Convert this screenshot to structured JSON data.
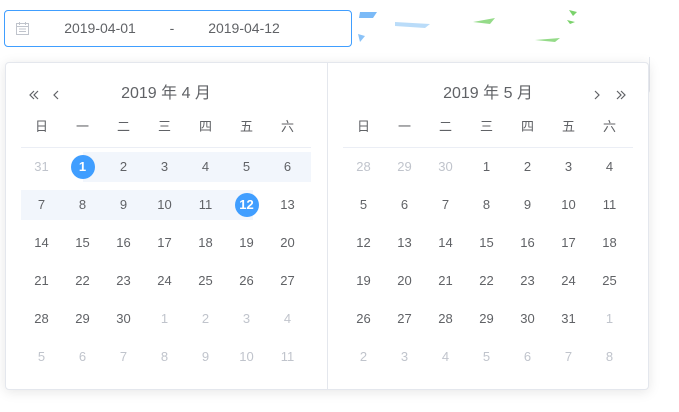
{
  "picker": {
    "start_value": "2019-04-01",
    "separator": "-",
    "end_value": "2019-04-12"
  },
  "left": {
    "title": "2019 年 4 月",
    "weekdays": [
      "日",
      "一",
      "二",
      "三",
      "四",
      "五",
      "六"
    ],
    "rows": [
      [
        "31",
        "1",
        "2",
        "3",
        "4",
        "5",
        "6"
      ],
      [
        "7",
        "8",
        "9",
        "10",
        "11",
        "12",
        "13"
      ],
      [
        "14",
        "15",
        "16",
        "17",
        "18",
        "19",
        "20"
      ],
      [
        "21",
        "22",
        "23",
        "24",
        "25",
        "26",
        "27"
      ],
      [
        "28",
        "29",
        "30",
        "1",
        "2",
        "3",
        "4"
      ],
      [
        "5",
        "6",
        "7",
        "8",
        "9",
        "10",
        "11"
      ]
    ]
  },
  "right": {
    "title": "2019 年 5 月",
    "weekdays": [
      "日",
      "一",
      "二",
      "三",
      "四",
      "五",
      "六"
    ],
    "rows": [
      [
        "28",
        "29",
        "30",
        "1",
        "2",
        "3",
        "4"
      ],
      [
        "5",
        "6",
        "7",
        "8",
        "9",
        "10",
        "11"
      ],
      [
        "12",
        "13",
        "14",
        "15",
        "16",
        "17",
        "18"
      ],
      [
        "19",
        "20",
        "21",
        "22",
        "23",
        "24",
        "25"
      ],
      [
        "26",
        "27",
        "28",
        "29",
        "30",
        "31",
        "1"
      ],
      [
        "2",
        "3",
        "4",
        "5",
        "6",
        "7",
        "8"
      ]
    ]
  },
  "colors": {
    "accent": "#409eff",
    "range": "#f2f6fc",
    "muted": "#c0c4cc"
  },
  "icons": {
    "input": "calendar-icon",
    "prev_year": "double-chevron-left-icon",
    "prev_month": "chevron-left-icon",
    "next_month": "chevron-right-icon",
    "next_year": "double-chevron-right-icon"
  }
}
